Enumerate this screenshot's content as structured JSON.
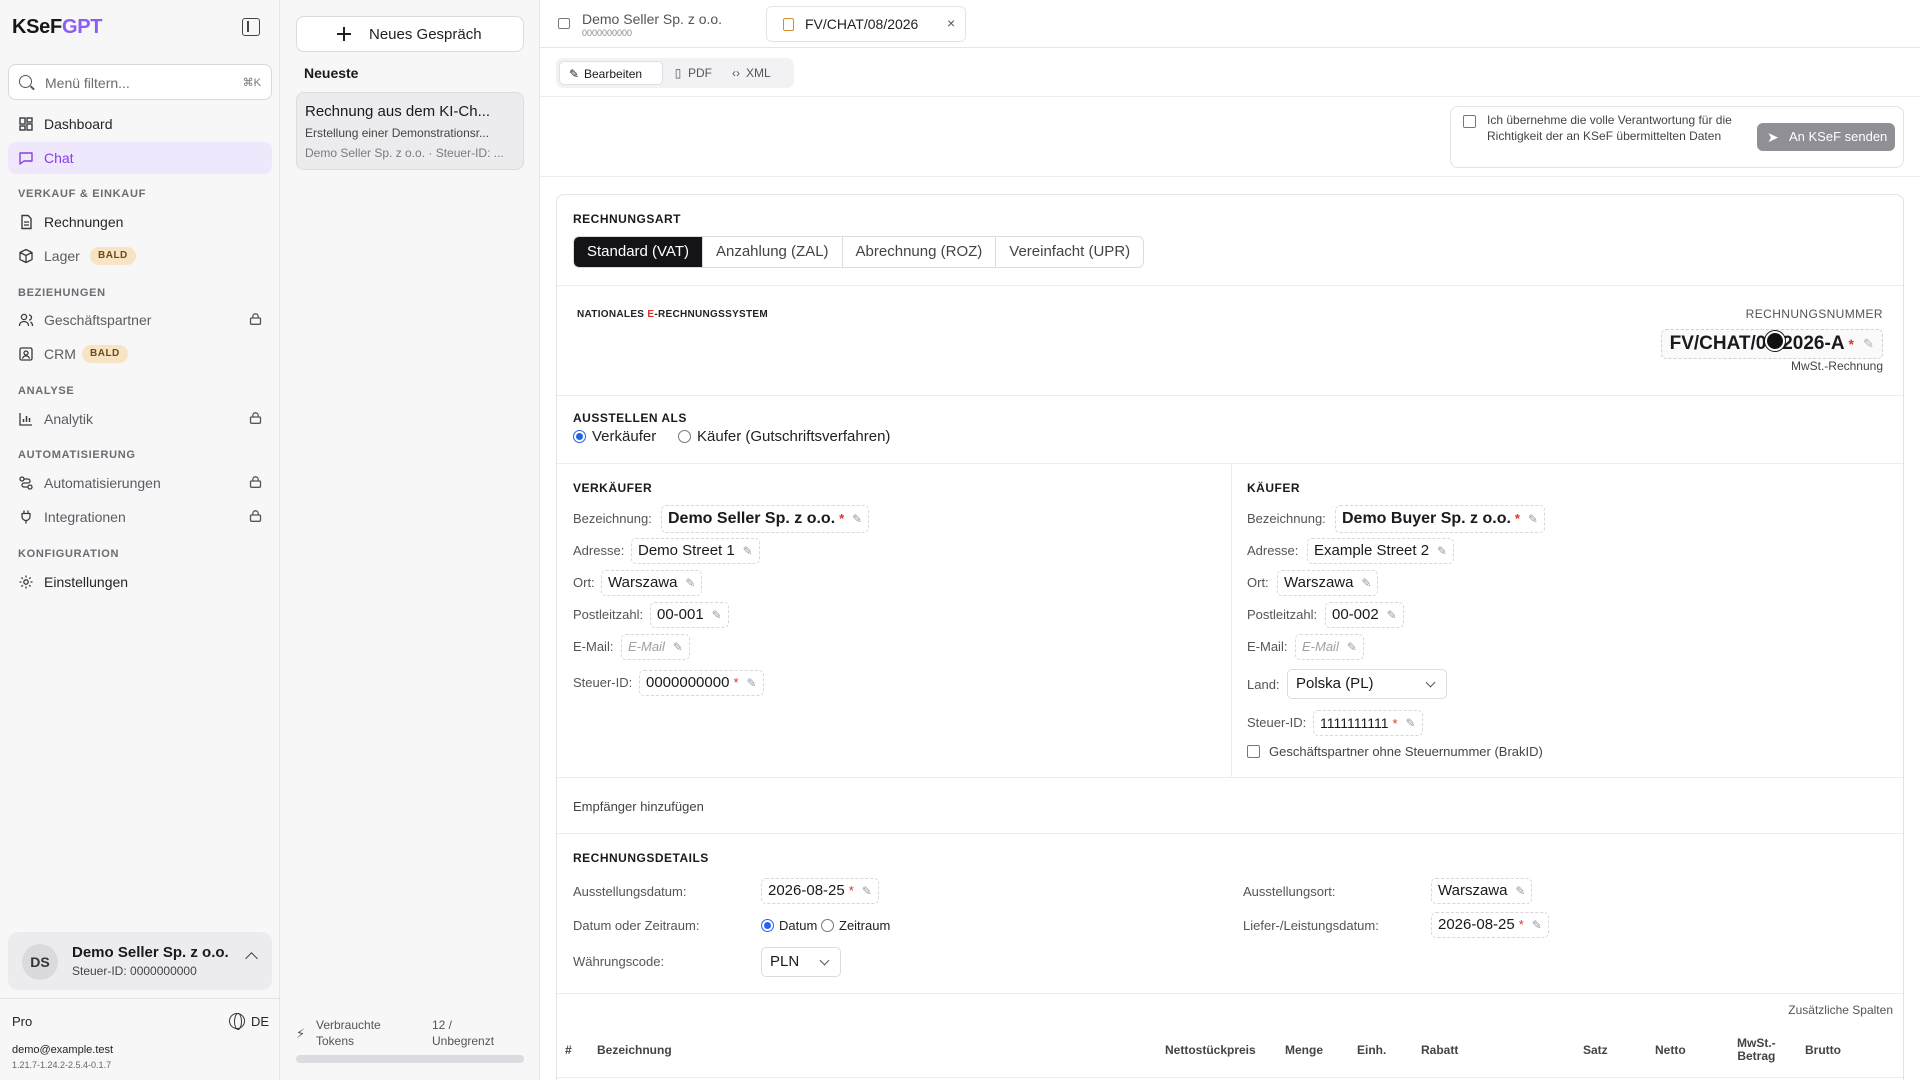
{
  "sidebar": {
    "logo": "KSeF",
    "logo_accent": "GPT",
    "search_placeholder": "Menü filtern...",
    "search_shortcut": "⌘K",
    "items": [
      {
        "label": "Dashboard",
        "icon": "dashboard-icon"
      },
      {
        "label": "Chat",
        "icon": "chat-icon",
        "active": true
      },
      {
        "label": "Rechnungen",
        "icon": "invoice-icon"
      },
      {
        "label": "Lager",
        "icon": "box-icon",
        "badge": "BALD"
      },
      {
        "label": "Geschäftspartner",
        "icon": "users-icon",
        "locked": true
      },
      {
        "label": "CRM",
        "icon": "contact-icon",
        "badge": "BALD"
      },
      {
        "label": "Analytik",
        "icon": "chart-icon",
        "locked": true
      },
      {
        "label": "Automatisierungen",
        "icon": "automation-icon",
        "locked": true
      },
      {
        "label": "Integrationen",
        "icon": "plug-icon",
        "locked": true
      },
      {
        "label": "Einstellungen",
        "icon": "gear-icon"
      }
    ],
    "sections": [
      "VERKAUF & EINKAUF",
      "BEZIEHUNGEN",
      "ANALYSE",
      "AUTOMATISIERUNG",
      "KONFIGURATION"
    ],
    "account": {
      "initials": "DS",
      "name": "Demo Seller Sp. z o.o.",
      "tax_id": "Steuer-ID: 0000000000"
    },
    "plan": "Pro",
    "language": "DE",
    "email": "demo@example.test",
    "version": "1.21.7-1.24.2-2.5.4-0.1.7"
  },
  "chat": {
    "new_chat": "Neues Gespräch",
    "recent_heading": "Neueste",
    "conversation": {
      "title": "Rechnung aus dem KI-Ch...",
      "subtitle": "Erstellung einer Demonstrationsr...",
      "meta": "Demo Seller Sp. z o.o. · Steuer-ID: ..."
    },
    "tokens_label_1": "Verbrauchte",
    "tokens_label_2": "Tokens",
    "tokens_value_1": "12 /",
    "tokens_value_2": "Unbegrenzt",
    "tokens_used_fraction": 0.0
  },
  "tabs": [
    {
      "title": "Demo Seller Sp. z o.o.",
      "subtitle": "0000000000"
    },
    {
      "title": "FV/CHAT/08/2026",
      "close": "×"
    }
  ],
  "view_tabs": [
    "Bearbeiten",
    "PDF",
    "XML"
  ],
  "confirm": {
    "text": "Ich übernehme die volle Verantwortung für die Richtigkeit der an KSeF übermittelten Daten",
    "send_button": "An KSeF senden"
  },
  "invoice": {
    "type_heading": "RECHNUNGSART",
    "types": [
      "Standard (VAT)",
      "Anzahlung (ZAL)",
      "Abrechnung (ROZ)",
      "Vereinfacht (UPR)"
    ],
    "selected_type": "Standard (VAT)",
    "brand_part1": "NATIONALES ",
    "brand_red": "E",
    "brand_part2": "-RECHNUNGSSYSTEM",
    "number_label": "RECHNUNGSNUMMER",
    "number": "FV/CHAT/08/2026-A",
    "invoice_type_text": "MwSt.-Rechnung",
    "issue_as_heading": "AUSSTELLEN ALS",
    "issue_as_options": [
      "Verkäufer",
      "Käufer (Gutschriftsverfahren)"
    ],
    "issue_as_selected": "Verkäufer",
    "seller": {
      "heading": "VERKÄUFER",
      "labels": {
        "name": "Bezeichnung:",
        "address": "Adresse:",
        "city": "Ort:",
        "zip": "Postleitzahl:",
        "email": "E-Mail:",
        "tax": "Steuer-ID:"
      },
      "name": "Demo Seller Sp. z o.o.",
      "address": "Demo Street 1",
      "city": "Warszawa",
      "zip": "00-001",
      "email_placeholder": "E-Mail",
      "tax_id": "0000000000"
    },
    "buyer": {
      "heading": "KÄUFER",
      "labels": {
        "name": "Bezeichnung:",
        "address": "Adresse:",
        "city": "Ort:",
        "zip": "Postleitzahl:",
        "email": "E-Mail:",
        "country": "Land:",
        "tax": "Steuer-ID:"
      },
      "name": "Demo Buyer Sp. z o.o.",
      "address": "Example Street 2",
      "city": "Warszawa",
      "zip": "00-002",
      "email_placeholder": "E-Mail",
      "country": "Polska (PL)",
      "tax_id": "1111111111",
      "no_tax_checkbox": "Geschäftspartner ohne Steuernummer (BrakID)"
    },
    "add_recipient": "Empfänger hinzufügen",
    "details": {
      "heading": "RECHNUNGSDETAILS",
      "issue_date_label": "Ausstellungsdatum:",
      "issue_date": "2026-08-25",
      "date_or_period_label": "Datum oder Zeitraum:",
      "date_options": [
        "Datum",
        "Zeitraum"
      ],
      "date_selected": "Datum",
      "currency_label": "Währungscode:",
      "currency": "PLN",
      "issue_place_label": "Ausstellungsort:",
      "issue_place": "Warszawa",
      "delivery_date_label": "Liefer-/Leistungsdatum:",
      "delivery_date": "2026-08-25"
    },
    "extra_columns": "Zusätzliche Spalten",
    "table_headers": {
      "num": "#",
      "name": "Bezeichnung",
      "unit_net": "Nettostückpreis",
      "qty": "Menge",
      "unit": "Einh.",
      "discount": "Rabatt",
      "rate": "Satz",
      "net": "Netto",
      "vat_1": "MwSt.-",
      "vat_2": "Betrag",
      "gross": "Brutto"
    }
  },
  "colors": {
    "accent": "#8a3ce8",
    "active_bg": "#efe7fc",
    "badge_bg": "#f8e4c5",
    "required": "#e0312b",
    "radio": "#2563eb"
  }
}
